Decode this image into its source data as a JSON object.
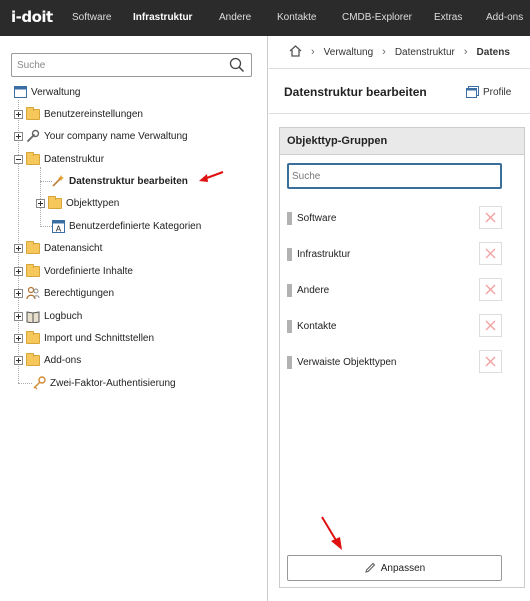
{
  "app": {
    "logo_text": "i-doit"
  },
  "topnav": {
    "items": [
      {
        "label": "Software",
        "active": false
      },
      {
        "label": "Infrastruktur",
        "active": true
      },
      {
        "label": "Andere",
        "active": false
      },
      {
        "label": "Kontakte",
        "active": false
      },
      {
        "label": "CMDB-Explorer",
        "active": false
      },
      {
        "label": "Extras",
        "active": false
      },
      {
        "label": "Add-ons",
        "active": false
      }
    ]
  },
  "sidebar": {
    "search_placeholder": "Suche",
    "tree": {
      "root": "Verwaltung",
      "items": [
        {
          "label": "Benutzereinstellungen",
          "icon": "folder-icon"
        },
        {
          "label": "Your company name Verwaltung",
          "icon": "wrench-icon"
        },
        {
          "label": "Datenstruktur",
          "icon": "folder-icon"
        },
        {
          "label": "Datenstruktur bearbeiten",
          "icon": "magic-wand-icon",
          "selected": true
        },
        {
          "label": "Objekttypen",
          "icon": "folder-icon"
        },
        {
          "label": "Benutzerdefinierte Kategorien",
          "icon": "custom-category-icon"
        },
        {
          "label": "Datenansicht",
          "icon": "folder-icon"
        },
        {
          "label": "Vordefinierte Inhalte",
          "icon": "folder-icon"
        },
        {
          "label": "Berechtigungen",
          "icon": "users-icon"
        },
        {
          "label": "Logbuch",
          "icon": "book-icon"
        },
        {
          "label": "Import und Schnittstellen",
          "icon": "folder-icon"
        },
        {
          "label": "Add-ons",
          "icon": "folder-icon"
        },
        {
          "label": "Zwei-Faktor-Authentisierung",
          "icon": "key-icon"
        }
      ]
    }
  },
  "breadcrumb": {
    "items": [
      "Verwaltung",
      "Datenstruktur",
      "Datens"
    ]
  },
  "main": {
    "title": "Datenstruktur bearbeiten",
    "profile_label": "Profile",
    "panel": {
      "title": "Objekttyp-Gruppen",
      "search_placeholder": "Suche",
      "groups": [
        "Software",
        "Infrastruktur",
        "Andere",
        "Kontakte",
        "Verwaiste Objekttypen"
      ],
      "adjust_label": "Anpassen"
    }
  },
  "colors": {
    "topbar_bg": "#2b2b2b",
    "annotation_arrow": "#e01010",
    "focus_border": "#3a6f9c",
    "delete_x": "#f2a0a0"
  }
}
